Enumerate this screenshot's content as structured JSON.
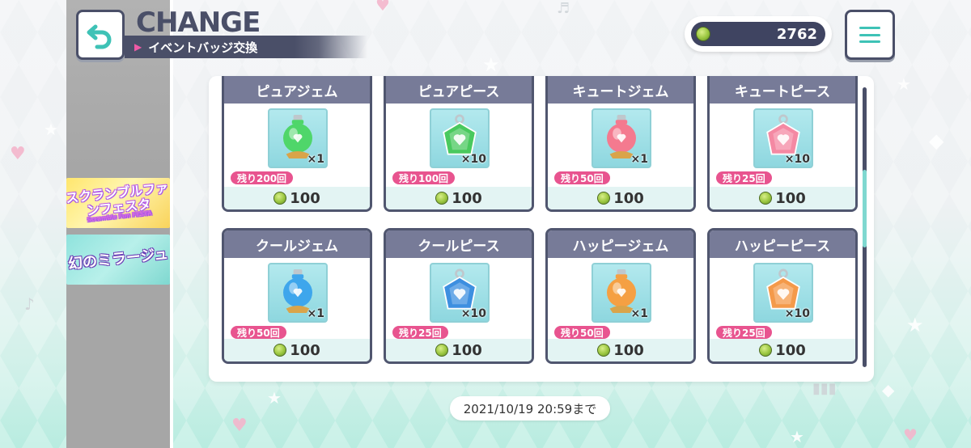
{
  "header": {
    "title": "CHANGE",
    "subtitle": "イベントバッジ交換"
  },
  "currency": {
    "value": "2762",
    "icon": "event-badge-icon"
  },
  "sidebar": {
    "banners": [
      {
        "title": "スクランブルファンフェスタ",
        "sub": "Scramble Fun FESTA"
      },
      {
        "title": "幻のミラージュ"
      }
    ]
  },
  "items": [
    {
      "name": "ピュアジェム",
      "qty": "×1",
      "limit": "残り200回",
      "price": "100",
      "kind": "gem",
      "color": "#4fd66a"
    },
    {
      "name": "ピュアピース",
      "qty": "×10",
      "limit": "残り100回",
      "price": "100",
      "kind": "piece",
      "color": "#49c95e"
    },
    {
      "name": "キュートジェム",
      "qty": "×1",
      "limit": "残り50回",
      "price": "100",
      "kind": "gem",
      "color": "#f47a8f"
    },
    {
      "name": "キュートピース",
      "qty": "×10",
      "limit": "残り25回",
      "price": "100",
      "kind": "piece",
      "color": "#f489a3"
    },
    {
      "name": "クールジェム",
      "qty": "×1",
      "limit": "残り50回",
      "price": "100",
      "kind": "gem",
      "color": "#3ea6ec"
    },
    {
      "name": "クールピース",
      "qty": "×10",
      "limit": "残り25回",
      "price": "100",
      "kind": "piece",
      "color": "#3d8fe0"
    },
    {
      "name": "ハッピージェム",
      "qty": "×1",
      "limit": "残り50回",
      "price": "100",
      "kind": "gem",
      "color": "#f5a043"
    },
    {
      "name": "ハッピーピース",
      "qty": "×10",
      "limit": "残り25回",
      "price": "100",
      "kind": "piece",
      "color": "#f49a4a"
    }
  ],
  "deadline": "2021/10/19 20:59まで",
  "colors": {
    "accent": "#4a4f68",
    "limit_badge": "#e8548f",
    "teal": "#7fd8d0"
  }
}
